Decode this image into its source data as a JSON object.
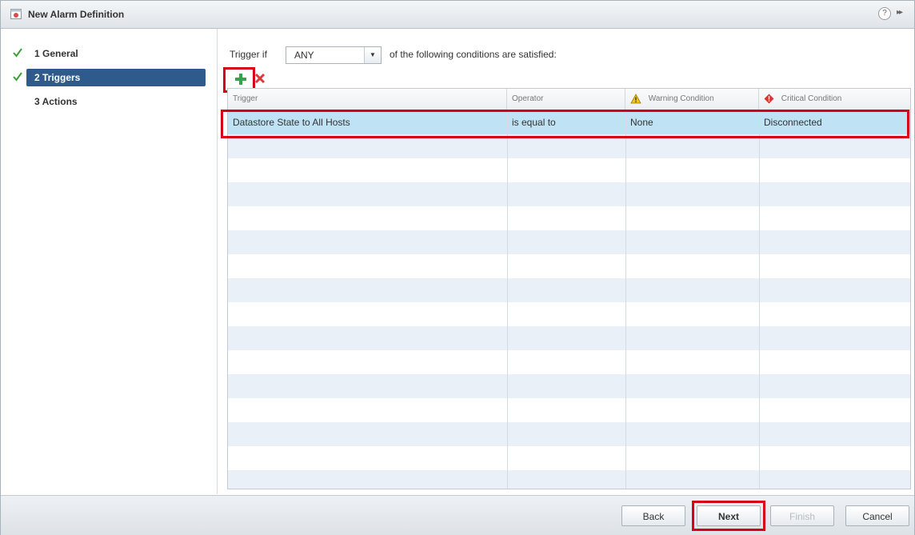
{
  "window": {
    "title": "New Alarm Definition",
    "help_symbol": "?",
    "expand_symbol": "▸▸"
  },
  "steps": [
    {
      "label": "1 General",
      "completed": true,
      "active": false
    },
    {
      "label": "2 Triggers",
      "completed": true,
      "active": true
    },
    {
      "label": "3 Actions",
      "completed": false,
      "active": false
    }
  ],
  "trigger_condition": {
    "prefix": "Trigger if",
    "selected": "ANY",
    "dropdown_arrow": "▼",
    "suffix": "of the following conditions are satisfied:"
  },
  "toolbar": {
    "add_icon": "plus-icon",
    "remove_icon": "delete-icon"
  },
  "table": {
    "columns": [
      "Trigger",
      "Operator",
      "Warning Condition",
      "Critical Condition"
    ],
    "rows": [
      {
        "trigger": "Datastore State to All Hosts",
        "operator": "is equal to",
        "warning": "None",
        "critical": "Disconnected"
      }
    ]
  },
  "footer": {
    "back": "Back",
    "next": "Next",
    "finish": "Finish",
    "cancel": "Cancel"
  },
  "colors": {
    "accent": "#2e5b8b",
    "selection": "#bfe3f5",
    "highlight": "#d7001a",
    "check": "#3aa03a"
  }
}
